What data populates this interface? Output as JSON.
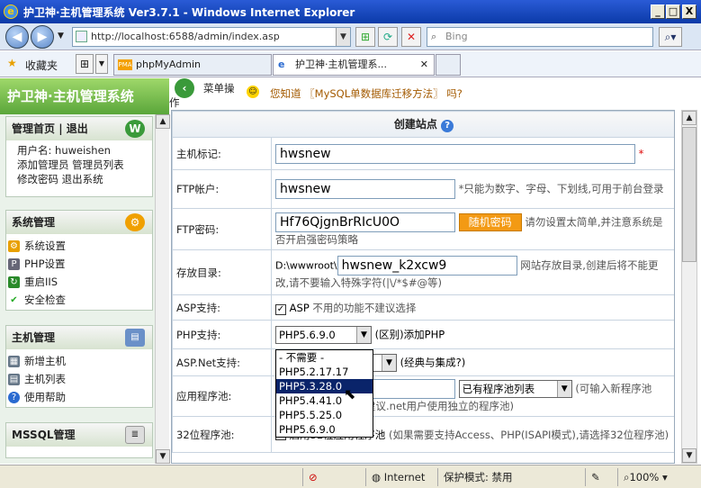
{
  "window": {
    "title": "护卫神·主机管理系统 Ver3.7.1 - Windows Internet Explorer",
    "minimize": "_",
    "maximize": "□",
    "close": "X"
  },
  "browser": {
    "address": "http://localhost:6588/admin/index.asp",
    "search_placeholder": "Bing",
    "favorites": "收藏夹",
    "tabs": [
      {
        "label": "phpMyAdmin"
      },
      {
        "label": "护卫神·主机管理系..."
      }
    ]
  },
  "app": {
    "brand": "护卫神·主机管理系统",
    "toolbar": {
      "menu_label": "菜单操作",
      "notice_prefix": "您知道",
      "notice_link": "〖MySQL单数据库迁移方法〗",
      "notice_suffix": "吗?"
    }
  },
  "sidebar": {
    "top_links": [
      {
        "label": "管理首页"
      },
      {
        "label": "退出"
      }
    ],
    "username_label": "用户名:",
    "username": "huweishen",
    "links_row1": [
      {
        "label": "添加管理员"
      },
      {
        "label": "管理员列表"
      }
    ],
    "links_row2": [
      {
        "label": "修改密码"
      },
      {
        "label": "退出系统"
      }
    ],
    "sections": [
      {
        "title": "系统管理",
        "items": [
          {
            "label": "系统设置",
            "icon": "gear-icon"
          },
          {
            "label": "PHP设置",
            "icon": "php-icon"
          },
          {
            "label": "重启IIS",
            "icon": "restart-icon"
          },
          {
            "label": "安全检查",
            "icon": "check-icon"
          }
        ]
      },
      {
        "title": "主机管理",
        "items": [
          {
            "label": "新增主机",
            "icon": "add-host-icon"
          },
          {
            "label": "主机列表",
            "icon": "list-icon"
          },
          {
            "label": "使用帮助",
            "icon": "help-icon"
          }
        ]
      },
      {
        "title": "MSSQL管理",
        "items": []
      }
    ]
  },
  "form": {
    "title": "创建站点",
    "rows": {
      "host": {
        "label": "主机标记:",
        "value": "hwsnew",
        "required": "*"
      },
      "ftp_user": {
        "label": "FTP帐户:",
        "value": "hwsnew",
        "hint": "*只能为数字、字母、下划线,可用于前台登录"
      },
      "ftp_pass": {
        "label": "FTP密码:",
        "value": "Hf76QjgnBrRIcU0O",
        "button": "随机密码",
        "hint": "请勿设置太简单,并注意系统是否开启强密码策略"
      },
      "dir": {
        "label": "存放目录:",
        "prefix": "D:\\wwwroot\\",
        "value": "hwsnew_k2xcw9",
        "hint": "网站存放目录,创建后将不能更改,请不要输入特殊字符(|\\/*$#@等)"
      },
      "asp": {
        "label": "ASP支持:",
        "check_label": "ASP",
        "hint": "不用的功能不建议选择"
      },
      "php": {
        "label": "PHP支持:",
        "selected": "PHP5.6.9.0",
        "suffix": "(区别)添加PHP"
      },
      "aspnet": {
        "label": "ASP.Net支持:",
        "suffix": "(经典与集成?)"
      },
      "pool": {
        "label": "应用程序池:",
        "select": "已有程序池列表",
        "hint": "(可输入新程序池",
        "hint2": "建议.net用户使用独立的程序池)"
      },
      "pool32": {
        "label": "32位程序池:",
        "check_label": "启用32位应用程序池",
        "hint": "(如果需要支持Access、PHP(ISAPI模式),请选择32位程序池)"
      }
    },
    "php_options": [
      "- 不需要 -",
      "PHP5.2.17.17",
      "PHP5.3.28.0",
      "PHP5.4.41.0",
      "PHP5.5.25.0",
      "PHP5.6.9.0"
    ],
    "php_highlighted": "PHP5.3.28.0"
  },
  "statusbar": {
    "zone": "Internet",
    "protected_mode": "保护模式: 禁用",
    "zoom": "100%"
  }
}
